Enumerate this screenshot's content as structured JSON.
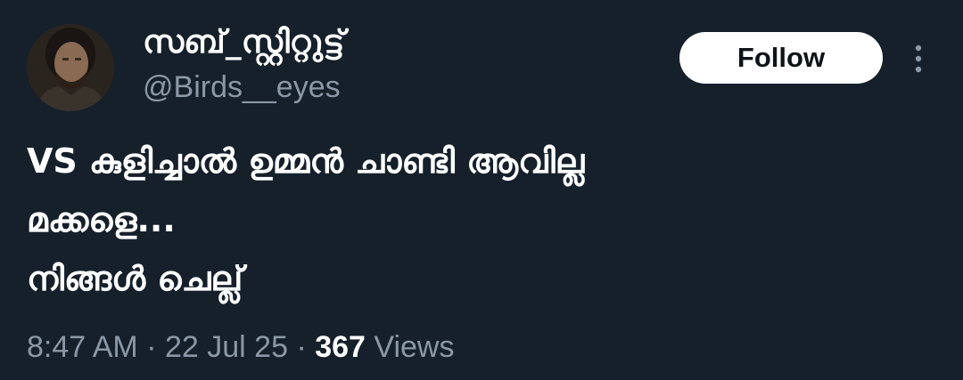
{
  "tweet": {
    "author": {
      "display_name": "സബ്_സ്റ്റിറ്റുട്ട്",
      "handle": "@Birds__eyes"
    },
    "follow_label": "Follow",
    "text_lines": [
      "VS കുളിച്ചാൽ ഉമ്മൻ ചാണ്ടി ആവില്ല",
      "മക്കളെ...",
      "നിങ്ങൾ ചെല്ല്"
    ],
    "meta": {
      "time": "8:47 AM",
      "separator": "·",
      "date": "22 Jul 25",
      "views_count": "367",
      "views_label": "Views"
    }
  },
  "colors": {
    "background": "#15202b",
    "primary_text": "#ffffff",
    "secondary_text": "#8b98a5",
    "follow_bg": "#ffffff",
    "follow_text": "#0f1419"
  },
  "icons": {
    "more": "more-vertical-icon"
  }
}
